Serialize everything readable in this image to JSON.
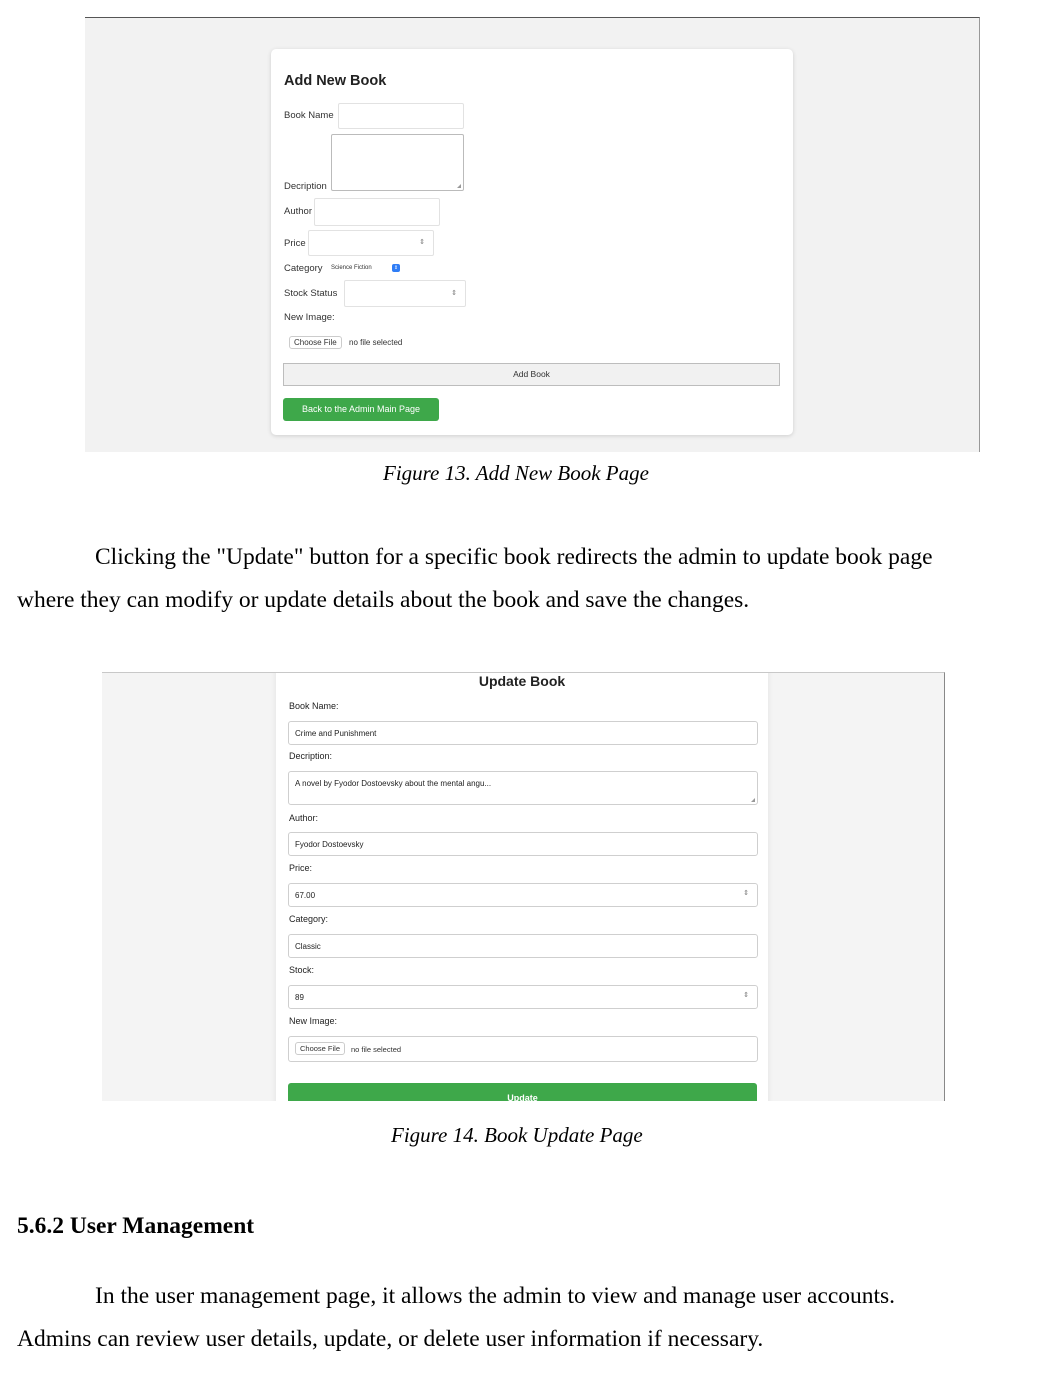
{
  "figure13": {
    "title": "Add New Book",
    "book_name_label": "Book Name",
    "description_label": "Decription",
    "author_label": "Author",
    "price_label": "Price",
    "category_label": "Category",
    "category_value": "Science Fiction",
    "stock_status_label": "Stock Status",
    "new_image_label": "New Image:",
    "choose_file": "Choose File",
    "no_file": "no file selected",
    "add_button": "Add Book",
    "back_button": "Back to the Admin Main Page",
    "caption": "Figure 13. Add New Book Page"
  },
  "paragraph1": {
    "line1": "Clicking the \"Update\" button for a specific book redirects the admin to update book page",
    "line2": "where they can modify or update details about the book and save the changes."
  },
  "figure14": {
    "title": "Update Book",
    "book_name_label": "Book Name:",
    "book_name_value": "Crime and Punishment",
    "description_label": "Decription:",
    "description_value": "A novel by Fyodor Dostoevsky about the mental angu...",
    "author_label": "Author:",
    "author_value": "Fyodor Dostoevsky",
    "price_label": "Price:",
    "price_value": "67.00",
    "category_label": "Category:",
    "category_value": "Classic",
    "stock_label": "Stock:",
    "stock_value": "89",
    "new_image_label": "New Image:",
    "choose_file": "Choose File",
    "no_file": "no file selected",
    "update_button": "Update",
    "caption": "Figure 14. Book Update Page"
  },
  "section": {
    "heading": "5.6.2 User Management",
    "line1": "In the user management page, it allows the admin to view and manage user accounts.",
    "line2": "Admins can review user details, update, or delete user information if necessary."
  },
  "icons": {
    "spinner": "updown-arrows-icon",
    "select_chevron": "select-chevron-icon",
    "resize_handle": "resize-handle-icon"
  }
}
